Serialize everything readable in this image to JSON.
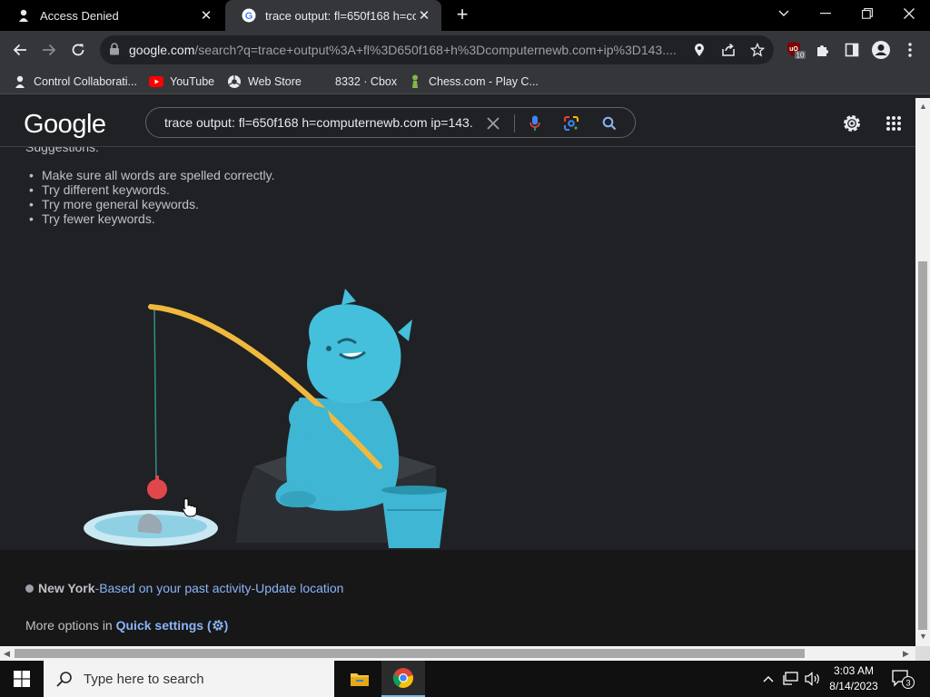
{
  "browser": {
    "tabs": [
      {
        "title": "Access Denied",
        "active": false
      },
      {
        "title": "trace output: fl=650f168 h=comp",
        "active": true
      }
    ],
    "url_host": "google.com",
    "url_path": "/search?q=trace+output%3A+fl%3D650f168+h%3Dcomputernewb.com+ip%3D143....",
    "extension_badge": "10",
    "bookmarks": [
      {
        "label": "Control Collaborati...",
        "icon": "puzzle-figure-icon"
      },
      {
        "label": "YouTube",
        "icon": "youtube-icon"
      },
      {
        "label": "Web Store",
        "icon": "web-store-icon"
      },
      {
        "label": "8332 · Cbox",
        "icon": "none"
      },
      {
        "label": "Chess.com - Play C...",
        "icon": "chess-pawn-icon"
      }
    ]
  },
  "google": {
    "logo": "Google",
    "query": "trace output: fl=650f168 h=computernewb.com ip=143.",
    "suggestions_title": "Suggestions:",
    "suggestions": [
      "Make sure all words are spelled correctly.",
      "Try different keywords.",
      "Try more general keywords.",
      "Try fewer keywords."
    ],
    "footer": {
      "location": "New York",
      "sep1": " - ",
      "past_activity": "Based on your past activity",
      "sep2": " - ",
      "update_location": "Update location",
      "more_options": "More options in ",
      "quick_settings": "Quick settings (",
      "quick_settings_close": ")"
    }
  },
  "taskbar": {
    "search_placeholder": "Type here to search",
    "time": "3:03 AM",
    "date": "8/14/2023",
    "notifications": "3"
  },
  "colors": {
    "page_bg": "#202124",
    "link": "#8ab4f8",
    "text": "#bdc1c6",
    "yeti": "#3fb6d3"
  }
}
